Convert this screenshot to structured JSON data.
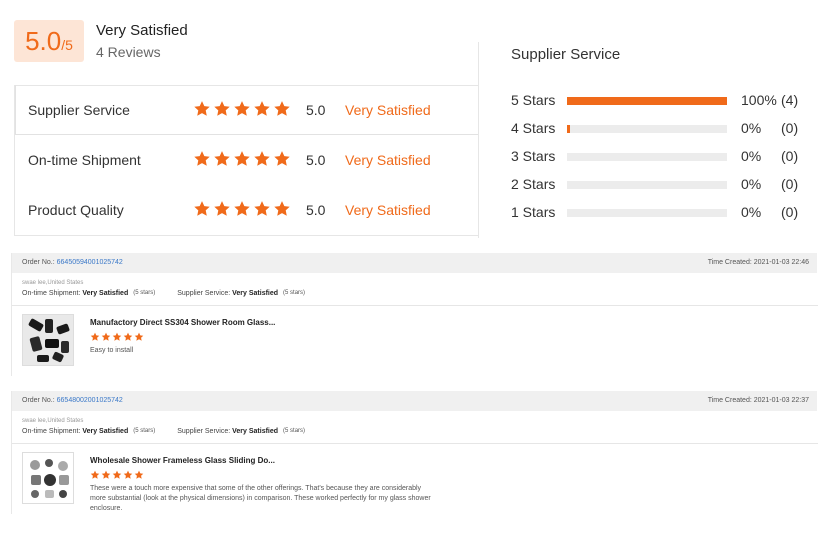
{
  "summary": {
    "score": "5.0",
    "score_max": "/5",
    "satisfaction": "Very Satisfied",
    "review_count": "4 Reviews"
  },
  "ratings": [
    {
      "label": "Supplier Service",
      "score": "5.0",
      "text": "Very Satisfied",
      "stars": 5
    },
    {
      "label": "On-time Shipment",
      "score": "5.0",
      "text": "Very Satisfied",
      "stars": 5
    },
    {
      "label": "Product Quality",
      "score": "5.0",
      "text": "Very Satisfied",
      "stars": 5
    }
  ],
  "distribution": {
    "title": "Supplier Service",
    "rows": [
      {
        "label": "5  Stars",
        "pct": "100%",
        "count": "(4)",
        "fill": 1.0
      },
      {
        "label": "4  Stars",
        "pct": "0%",
        "count": "(0)",
        "fill": 0.02
      },
      {
        "label": "3  Stars",
        "pct": "0%",
        "count": "(0)",
        "fill": 0
      },
      {
        "label": "2  Stars",
        "pct": "0%",
        "count": "(0)",
        "fill": 0
      },
      {
        "label": "1  Stars",
        "pct": "0%",
        "count": "(0)",
        "fill": 0
      }
    ]
  },
  "reviews": [
    {
      "order_label": "Order No.:",
      "order_no": "66450594001025742",
      "created": "Time Created: 2021-01-03 22:46",
      "buyer": "swae lee,United States",
      "shipment_label": "On-time Shipment:",
      "shipment_value": "Very Satisfied",
      "shipment_stars": "(5 stars)",
      "service_label": "Supplier Service:",
      "service_value": "Very Satisfied",
      "service_stars": "(5 stars)",
      "product_title": "Manufactory Direct SS304 Shower Room Glass...",
      "comment": "Easy to install"
    },
    {
      "order_label": "Order No.:",
      "order_no": "66548002001025742",
      "created": "Time Created: 2021-01-03 22:37",
      "buyer": "swae lee,United States",
      "shipment_label": "On-time Shipment:",
      "shipment_value": "Very Satisfied",
      "shipment_stars": "(5 stars)",
      "service_label": "Supplier Service:",
      "service_value": "Very Satisfied",
      "service_stars": "(5 stars)",
      "product_title": "Wholesale Shower Frameless Glass Sliding Do...",
      "comment": "These were a touch more expensive that some of the other offerings. That's because they are considerably more substantial (look at the physical dimensions) in comparison. These worked perfectly for my glass shower enclosure."
    }
  ],
  "icons": {
    "star": "star-icon"
  },
  "colors": {
    "accent": "#f06a1a",
    "score_bg": "#fde5d6",
    "bar_bg": "#ececec",
    "link": "#3a78c8"
  }
}
